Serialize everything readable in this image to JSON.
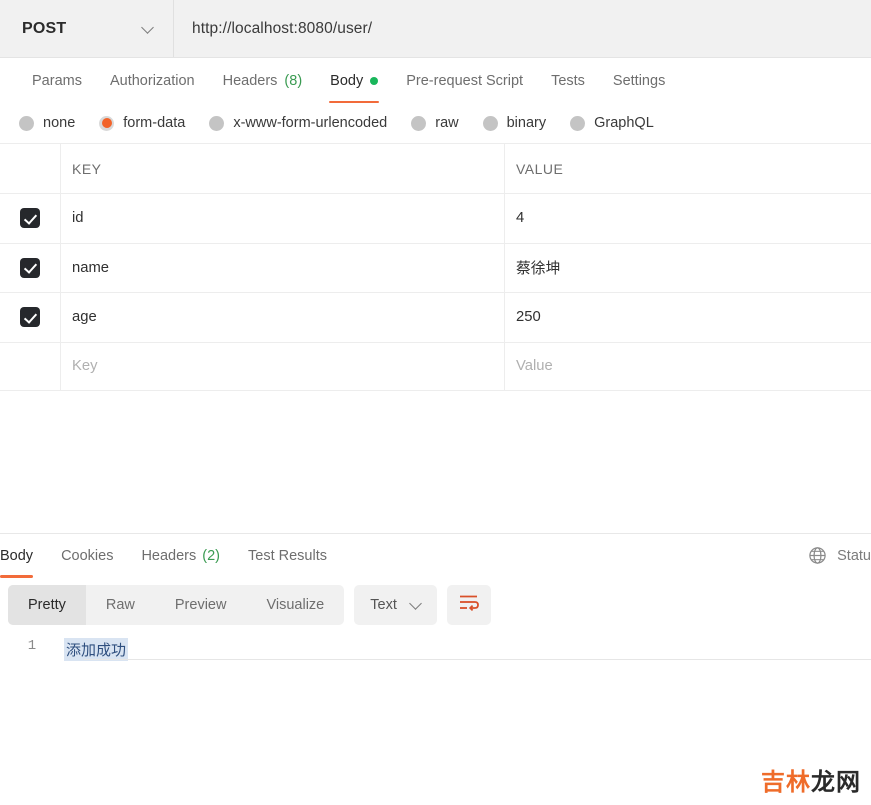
{
  "request": {
    "method": "POST",
    "url": "http://localhost:8080/user/",
    "method_chevron_icon": "chevron-down-icon",
    "tabs": [
      {
        "label": "Params",
        "count": "",
        "active": false,
        "dot": false
      },
      {
        "label": "Authorization",
        "count": "",
        "active": false,
        "dot": false
      },
      {
        "label": "Headers",
        "count": "(8)",
        "active": false,
        "dot": false
      },
      {
        "label": "Body",
        "count": "",
        "active": true,
        "dot": true
      },
      {
        "label": "Pre-request Script",
        "count": "",
        "active": false,
        "dot": false
      },
      {
        "label": "Tests",
        "count": "",
        "active": false,
        "dot": false
      },
      {
        "label": "Settings",
        "count": "",
        "active": false,
        "dot": false
      }
    ],
    "body_types": [
      {
        "label": "none",
        "selected": false
      },
      {
        "label": "form-data",
        "selected": true
      },
      {
        "label": "x-www-form-urlencoded",
        "selected": false
      },
      {
        "label": "raw",
        "selected": false
      },
      {
        "label": "binary",
        "selected": false
      },
      {
        "label": "GraphQL",
        "selected": false
      }
    ],
    "table": {
      "headers": {
        "key": "KEY",
        "value": "VALUE"
      },
      "rows": [
        {
          "checked": true,
          "key": "id",
          "value": "4"
        },
        {
          "checked": true,
          "key": "name",
          "value": "蔡徐坤"
        },
        {
          "checked": true,
          "key": "age",
          "value": "250"
        }
      ],
      "placeholder_row": {
        "key": "Key",
        "value": "Value"
      }
    }
  },
  "response": {
    "tabs": [
      {
        "label": "Body",
        "count": "",
        "active": true
      },
      {
        "label": "Cookies",
        "count": "",
        "active": false
      },
      {
        "label": "Headers",
        "count": "(2)",
        "active": false
      },
      {
        "label": "Test Results",
        "count": "",
        "active": false
      }
    ],
    "status": {
      "icon": "globe-icon",
      "label": "Statu"
    },
    "viewer": {
      "modes": [
        {
          "label": "Pretty",
          "active": true
        },
        {
          "label": "Raw",
          "active": false
        },
        {
          "label": "Preview",
          "active": false
        },
        {
          "label": "Visualize",
          "active": false
        }
      ],
      "language": "Text",
      "language_chevron_icon": "chevron-down-icon",
      "wrap_icon": "word-wrap-icon"
    },
    "body": {
      "line_number": "1",
      "content": "添加成功"
    }
  },
  "watermark": {
    "part1": "吉林",
    "part2": "龙网"
  },
  "colors": {
    "accent_orange": "#f26b3a",
    "green": "#3a9b52",
    "dot_green": "#19b65b",
    "radio_selected": "#f2632a",
    "checkbox_dark": "#26282c",
    "selection_blue": "#d9e4f2"
  }
}
